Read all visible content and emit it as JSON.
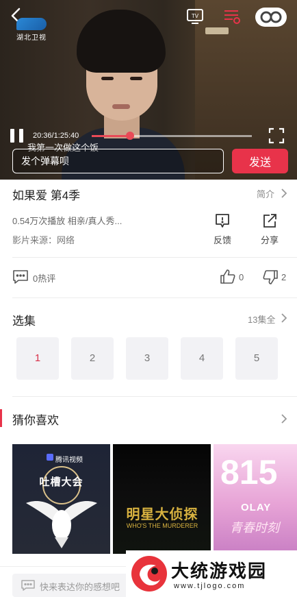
{
  "player": {
    "channel_logo_text": "湖北卫视",
    "time": "20:36/1:25:40",
    "progress_fraction": 0.24,
    "danmaku_text": "我第一次做这个饭",
    "danmaku_placeholder": "发个弹幕呗",
    "send_label": "发送"
  },
  "info": {
    "title": "如果爱 第4季",
    "intro_label": "简介",
    "meta": "0.54万次播放 相亲/真人秀...",
    "source": "影片来源：网络",
    "actions": [
      {
        "label": "反馈",
        "icon": "feedback-icon"
      },
      {
        "label": "分享",
        "icon": "share-icon"
      }
    ]
  },
  "engagement": {
    "comments": "0热评",
    "likes": "0",
    "dislikes": "2"
  },
  "episodes": {
    "title": "选集",
    "total_label": "13集全",
    "items": [
      "1",
      "2",
      "3",
      "4",
      "5"
    ],
    "active_index": 0
  },
  "recommend": {
    "title": "猜你喜欢",
    "posters": [
      {
        "tag": "腾讯视频",
        "title": "吐槽大会"
      },
      {
        "title": "明星大侦探",
        "subtitle": "WHO'S THE MURDERER"
      },
      {
        "number": "815",
        "brand": "OLAY",
        "caption": "青春时刻"
      }
    ]
  },
  "bottom": {
    "comment_placeholder": "快来表达你的感想吧"
  },
  "watermark": {
    "title": "大统游戏园",
    "url": "www.tjlogo.com"
  },
  "colors": {
    "accent": "#e8334a",
    "active_episode": "#d8314a"
  }
}
